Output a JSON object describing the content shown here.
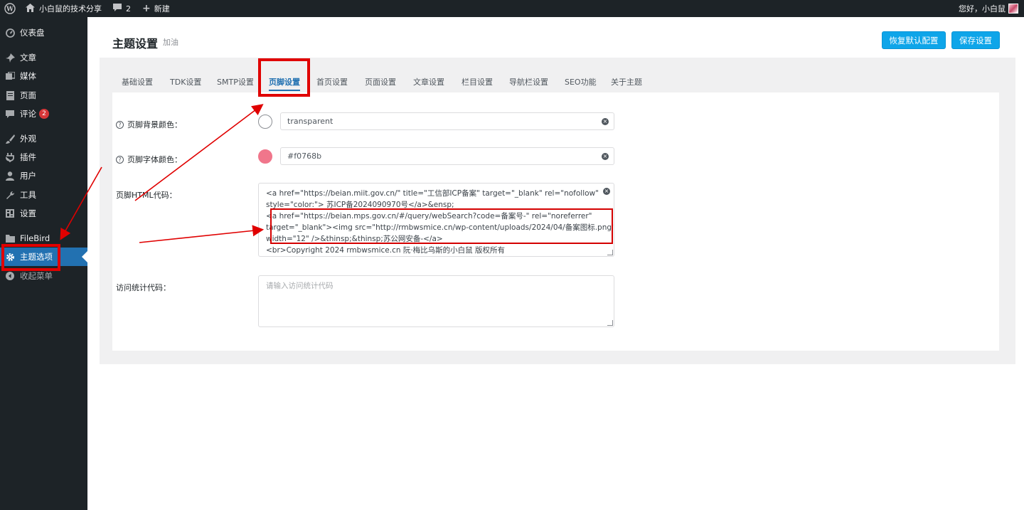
{
  "adminbar": {
    "site_name": "小白鼠的技术分享",
    "comments_count": "2",
    "new_label": "新建",
    "greeting": "您好，小白鼠"
  },
  "sidebar": {
    "items": [
      {
        "label": "仪表盘",
        "icon": "dashboard-icon"
      },
      {
        "label": "文章",
        "icon": "pin-icon"
      },
      {
        "label": "媒体",
        "icon": "media-icon"
      },
      {
        "label": "页面",
        "icon": "page-icon"
      },
      {
        "label": "评论",
        "icon": "comment-icon",
        "badge": "2"
      },
      {
        "label": "外观",
        "icon": "brush-icon"
      },
      {
        "label": "插件",
        "icon": "plugin-icon"
      },
      {
        "label": "用户",
        "icon": "user-icon"
      },
      {
        "label": "工具",
        "icon": "wrench-icon"
      },
      {
        "label": "设置",
        "icon": "settings-icon"
      },
      {
        "label": "FileBird",
        "icon": "folder-icon"
      },
      {
        "label": "主题选项",
        "icon": "gear-icon"
      },
      {
        "label": "收起菜单",
        "icon": "collapse-icon"
      }
    ]
  },
  "header": {
    "title": "主题设置",
    "subtitle": "加油",
    "reset_label": "恢复默认配置",
    "save_label": "保存设置"
  },
  "tabs": [
    "基础设置",
    "TDK设置",
    "SMTP设置",
    "页脚设置",
    "首页设置",
    "页面设置",
    "文章设置",
    "栏目设置",
    "导航栏设置",
    "SEO功能",
    "关于主题"
  ],
  "active_tab": "页脚设置",
  "form": {
    "bg_color": {
      "label": "页脚背景颜色：",
      "value": "transparent",
      "swatch": "#ffffff"
    },
    "font_color": {
      "label": "页脚字体颜色：",
      "value": "#f0768b",
      "swatch": "#f0768b"
    },
    "html_code": {
      "label": "页脚HTML代码：",
      "lines": [
        "<a href=\"https://beian.miit.gov.cn/\" title=\"工信部ICP备案\" target=\"_blank\" rel=\"nofollow\"",
        "style=\"color:\"> 苏ICP备2024090970号</a>&ensp;",
        "<a href=\"https://beian.mps.gov.cn/#/query/webSearch?code=备案号-\" rel=\"noreferrer\"",
        "target=\"_blank\"><img src=\"http://rmbwsmice.cn/wp-content/uploads/2024/04/备案图标.png\"",
        "width=\"12\" />&thinsp;&thinsp;苏公网安备-</a>",
        "<br>Copyright 2024 rmbwsmice.cn 阮·梅比乌斯的小白鼠 版权所有"
      ]
    },
    "stats_code": {
      "label": "访问统计代码：",
      "placeholder": "请输入访问统计代码"
    }
  },
  "colors": {
    "admin_dark": "#1d2327",
    "accent": "#2271b1",
    "button": "#0ea5e9",
    "annotation": "#e00000"
  }
}
